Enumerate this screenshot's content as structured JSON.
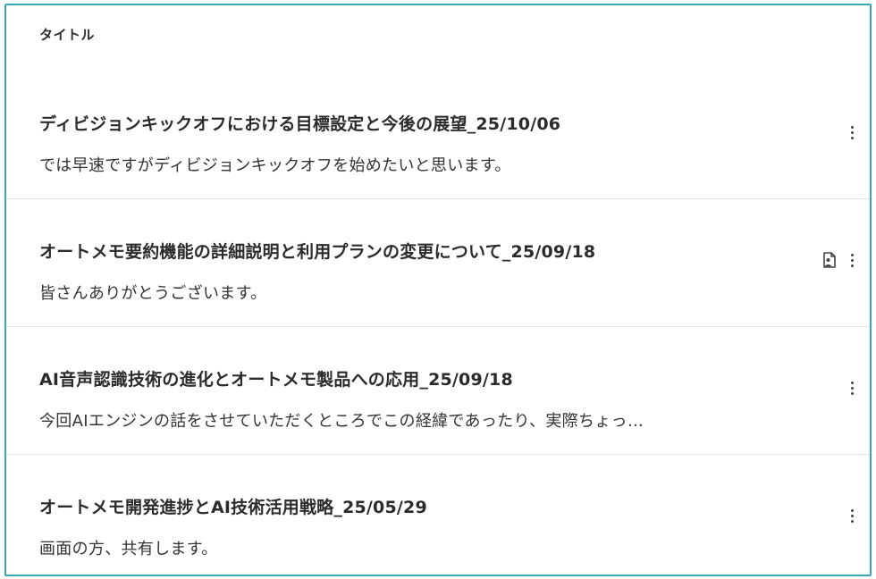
{
  "header": {
    "title": "タイトル"
  },
  "items": [
    {
      "title": "ディビジョンキックオフにおける目標設定と今後の展望_25/10/06",
      "snippet": "では早速ですがディビジョンキックオフを始めたいと思います。",
      "has_doc_icon": false
    },
    {
      "title": "オートメモ要約機能の詳細説明と利用プランの変更について_25/09/18",
      "snippet": "皆さんありがとうございます。",
      "has_doc_icon": true
    },
    {
      "title": "AI音声認識技術の進化とオートメモ製品への応用_25/09/18",
      "snippet": "今回AIエンジンの話をさせていただくところでこの経緯であったり、実際ちょっ…",
      "has_doc_icon": false
    },
    {
      "title": "オートメモ開発進捗とAI技術活用戦略_25/05/29",
      "snippet": "画面の方、共有します。",
      "has_doc_icon": false
    }
  ],
  "colors": {
    "frame_border": "#35aab4",
    "divider": "#e0e0e0",
    "text": "#2b2b2b"
  },
  "icons": {
    "more": "more-vertical-icon",
    "doc": "document-user-icon"
  }
}
